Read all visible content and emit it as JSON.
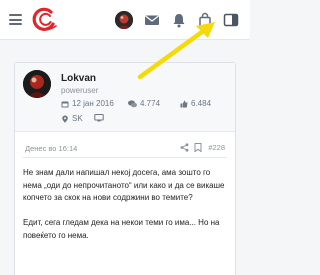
{
  "icons": {
    "menu": "hamburger-icon",
    "logo": "site-logo",
    "messages": "envelope-icon",
    "notifications": "bell-icon",
    "shop": "bag-icon",
    "sidebar_toggle": "sidebar-toggle-icon"
  },
  "colors": {
    "brand": "#e3242b",
    "highlight": "#f5d90a",
    "icon": "#5f6b7a"
  },
  "post": {
    "author": {
      "name": "Lokvan",
      "role": "poweruser",
      "joined": "12 јан 2016",
      "posts": "4.774",
      "likes": "6.484",
      "country": "SK"
    },
    "date": "Денес во 16:14",
    "number": "#228",
    "paragraphs": [
      "Не знам дали напишал некој досега, ама зошто го нема „оди до непрочитаното“ или како и да се викаше копчето за скок на нови содржини во темите?",
      "Едит, сега гледам дека на некои теми го има... Но на повеќето го нема."
    ]
  }
}
